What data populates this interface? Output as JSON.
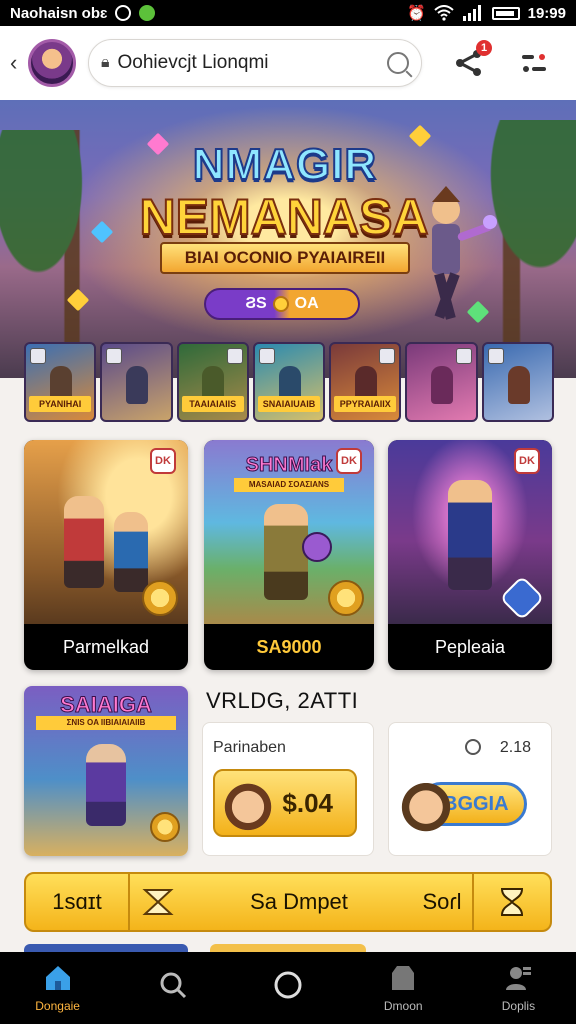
{
  "status_bar": {
    "carrier": "Naohaisn obɛ",
    "time": "19:99"
  },
  "app_bar": {
    "search_query": "Oohievcjt Lionqmi",
    "notification_count": "1"
  },
  "hero": {
    "title_line1": "NMAGIR",
    "title_line2": "NEMANASA",
    "subtitle": "BIAI OCONIO PYAIAIREII",
    "pill_left": "ϨS",
    "pill_right": "OA"
  },
  "thumbnails": [
    {
      "label": "PYANIHAI",
      "color_a": "#3b6fb3",
      "color_b": "#d98a3a"
    },
    {
      "label": "",
      "color_a": "#5a4a8a",
      "color_b": "#c9a36a"
    },
    {
      "label": "TAAIAIAIIS",
      "color_a": "#2f6a3a",
      "color_b": "#a88a4a"
    },
    {
      "label": "SNAIAIUAIB",
      "color_a": "#2a8ab0",
      "color_b": "#d7c06a"
    },
    {
      "label": "PPYRAIAIIX",
      "color_a": "#7a3a3a",
      "color_b": "#d98a3a"
    },
    {
      "label": "",
      "color_a": "#7a3a7a",
      "color_b": "#e27ab0"
    },
    {
      "label": "",
      "color_a": "#3a6ab0",
      "color_b": "#b0c0e0"
    }
  ],
  "cards": [
    {
      "caption": "Parmelkad",
      "badge": "DK"
    },
    {
      "caption": "SA9000",
      "badge": "DK",
      "art_title": "SHNMIak",
      "art_sub": "MASAIAD ΣOAΣIANS"
    },
    {
      "caption": "Pepleaia",
      "badge": "DK"
    }
  ],
  "promo": {
    "title": "SAIAIGA",
    "subtitle": "ΣNIS OA IIBIAIAIAIIB",
    "mark": "Σ"
  },
  "section": {
    "heading": "VRLDG, 2ATTI",
    "offer_left_label": "Parinaben",
    "offer_left_price": "$.04",
    "offer_right_timer": "2.18",
    "offer_right_pill": "IBGGIA"
  },
  "action_bar": {
    "left": "1sɑɪt",
    "middle": "Sa Dmpet",
    "right": "Soɾl"
  },
  "bottom_nav": [
    {
      "label": "Dongaie",
      "icon": "home-icon",
      "active": true
    },
    {
      "label": "",
      "icon": "search-icon",
      "active": false
    },
    {
      "label": "",
      "icon": "circle-icon",
      "active": false
    },
    {
      "label": "Dmoon",
      "icon": "store-icon",
      "active": false
    },
    {
      "label": "Doplis",
      "icon": "profile-icon",
      "active": false
    }
  ],
  "colors": {
    "accent_gold": "#f4b41a",
    "nav_active": "#ffb640",
    "badge_red": "#e03030"
  }
}
